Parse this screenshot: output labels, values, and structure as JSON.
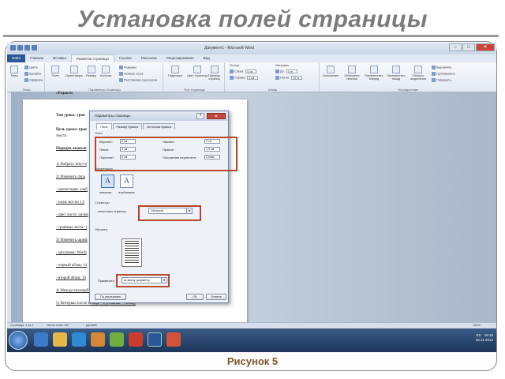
{
  "slide": {
    "title": "Установка полей страницы",
    "caption": "Рисунок 5"
  },
  "window": {
    "title": "Документ1 - Microsoft Word",
    "min": "–",
    "max": "□",
    "close": "✕"
  },
  "tabs": [
    "Файл",
    "Главная",
    "Вставка",
    "Разметка страницы",
    "Ссылки",
    "Рассылки",
    "Рецензирование",
    "Вид"
  ],
  "ribbon": {
    "groups": [
      "Темы",
      "Параметры страницы",
      "Фон страницы",
      "Абзац",
      "Упорядочение"
    ],
    "themes": {
      "btn": "Темы",
      "colors": "Цвета",
      "fonts": "Шрифты",
      "effects": "Эффекты"
    },
    "page_setup": [
      "Поля",
      "Ориентация",
      "Размер",
      "Колонки"
    ],
    "page_setup_small": [
      "Разрывы",
      "Номера строк",
      "Расстановка переносов"
    ],
    "background": [
      "Подложка",
      "Цвет страницы",
      "Границы страниц"
    ],
    "indent": {
      "label": "Отступ",
      "left": "Слева:",
      "right": "Справа:",
      "left_val": "0 см",
      "right_val": "0 см"
    },
    "spacing": {
      "label": "Интервал",
      "before": "До:",
      "after": "После:",
      "before_val": "0 пт",
      "after_val": "10 пт"
    },
    "arrange": [
      "Положение",
      "Обтекание текстом",
      "Переместить вперед",
      "Переместить назад",
      "Область выделения"
    ],
    "arrange_small": [
      "Выровнять",
      "Группировать",
      "Повернуть"
    ]
  },
  "document": {
    "lines": [
      {
        "text": "«Редакти",
        "cls": "b"
      },
      {
        "text": "Тип урока: урок",
        "cls": "b"
      },
      {
        "text": "Цель урока: прое",
        "cls": "b"
      },
      {
        "text": "текста.",
        "cls": ""
      },
      {
        "text": "Порядок выполн",
        "cls": "b u"
      },
      {
        "text": "1) Набрать текст в",
        "cls": "u"
      },
      {
        "text": "2) Изменить пара",
        "cls": "u"
      },
      {
        "text": "- ориентация: альб",
        "cls": "u"
      },
      {
        "text": "- поля: все по 1,5",
        "cls": "u"
      },
      {
        "text": "- цвет листа: лилов",
        "cls": "u"
      },
      {
        "text": "- границы листа: 1",
        "cls": "u"
      },
      {
        "text": "3) Изменить шриф",
        "cls": "u"
      },
      {
        "text": "- заголовок: Wordl",
        "cls": "u"
      },
      {
        "text": "- первый абзац: 14",
        "cls": "u"
      },
      {
        "text": "- второй абзац: 16",
        "cls": "u"
      },
      {
        "text": "4) Междустрочный интервал – 1,5 (Главная – Абзац)",
        "cls": "u"
      },
      {
        "text": "5) Интервал после абзаца – 0 (Главная – Абзац)",
        "cls": "u"
      }
    ]
  },
  "dialog": {
    "title": "Параметры страницы",
    "help": "?",
    "close": "✕",
    "tabs": [
      "Поля",
      "Размер бумаги",
      "Источник бумаги"
    ],
    "margins_label": "Поля",
    "top_label": "Верхнее:",
    "top_val": "2 см",
    "bottom_label": "Нижнее:",
    "bottom_val": "2 см",
    "left_label": "Левое:",
    "left_val": "3 см",
    "right_label": "Правое:",
    "right_val": "1,5 см",
    "gutter_label": "Переплет:",
    "gutter_val": "0 см",
    "gutter_pos_label": "Положение переплета:",
    "gutter_pos_val": "Слева",
    "orientation_label": "Ориентация",
    "portrait": "книжная",
    "landscape": "альбомная",
    "pages_label": "Страницы",
    "multiple_label": "несколько страниц:",
    "multiple_val": "Обычный",
    "sample_label": "Образец",
    "apply_label": "Применить:",
    "apply_val": "ко всему документу",
    "default_btn": "По умолчанию",
    "ok_btn": "ОК",
    "cancel_btn": "Отмена"
  },
  "status": {
    "page": "Страница: 1 из 1",
    "words": "Число слов: 167",
    "lang": "русский",
    "zoom": "100%"
  },
  "tray": {
    "lang": "RU",
    "time": "16:15",
    "date": "26.11.2012"
  },
  "colors": {
    "highlight": "#b5472a",
    "title": "#7b7b7b",
    "caption": "#7b5a2a"
  }
}
